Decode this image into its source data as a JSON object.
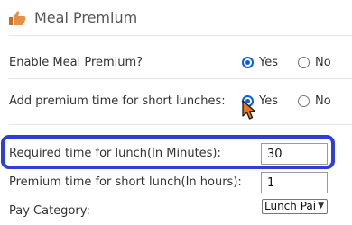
{
  "header": {
    "title": "Meal Premium",
    "icon": "thumbs-up-icon",
    "icon_color": "#d47a2c"
  },
  "rows": {
    "enable": {
      "label": "Enable Meal Premium?",
      "yes": "Yes",
      "no": "No",
      "selected": "Yes"
    },
    "short_lunch": {
      "label": "Add premium time for short lunches:",
      "yes": "Yes",
      "no": "No",
      "selected": "Yes"
    },
    "required_time": {
      "label": "Required time for lunch(In Minutes):",
      "value": "30"
    },
    "premium_time": {
      "label": "Premium time for short lunch(In hours):",
      "value": "1"
    },
    "pay_category": {
      "label": "Pay Category:",
      "selected": "Lunch Pai"
    }
  },
  "colors": {
    "highlight": "#2d3fd4",
    "radio_accent": "#0a5fd6",
    "cursor": "#e8741f"
  }
}
